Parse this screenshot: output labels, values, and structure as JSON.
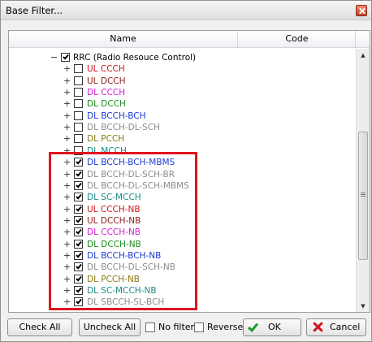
{
  "window": {
    "title": "Base Filter..."
  },
  "columns": {
    "name": "Name",
    "code": "Code"
  },
  "tree": {
    "root": {
      "expander": "−",
      "checked": true,
      "label": "RRC (Radio Resouce Control)",
      "color": "#000000"
    },
    "items": [
      {
        "expander": "+",
        "checked": false,
        "label": "UL CCCH",
        "color": "#d4141a"
      },
      {
        "expander": "+",
        "checked": false,
        "label": "UL DCCH",
        "color": "#8b1a1a"
      },
      {
        "expander": "+",
        "checked": false,
        "label": "DL CCCH",
        "color": "#d51dd6"
      },
      {
        "expander": "+",
        "checked": false,
        "label": "DL DCCH",
        "color": "#1c8a1c"
      },
      {
        "expander": "+",
        "checked": false,
        "label": "DL BCCH-BCH",
        "color": "#1c3ad2"
      },
      {
        "expander": "+",
        "checked": false,
        "label": "DL BCCH-DL-SCH",
        "color": "#8c8c8c"
      },
      {
        "expander": "+",
        "checked": false,
        "label": "DL PCCH",
        "color": "#8a7a10"
      },
      {
        "expander": "+",
        "checked": false,
        "label": "DL MCCH",
        "color": "#1a8a8a"
      },
      {
        "expander": "+",
        "checked": true,
        "label": "DL BCCH-BCH-MBMS",
        "color": "#1c3ad2"
      },
      {
        "expander": "+",
        "checked": true,
        "label": "DL BCCH-DL-SCH-BR",
        "color": "#8c8c8c"
      },
      {
        "expander": "+",
        "checked": true,
        "label": "DL BCCH-DL-SCH-MBMS",
        "color": "#8c8c8c"
      },
      {
        "expander": "+",
        "checked": true,
        "label": "DL SC-MCCH",
        "color": "#1a8a8a"
      },
      {
        "expander": "+",
        "checked": true,
        "label": "UL CCCH-NB",
        "color": "#d4141a"
      },
      {
        "expander": "+",
        "checked": true,
        "label": "UL DCCH-NB",
        "color": "#8b1a1a"
      },
      {
        "expander": "+",
        "checked": true,
        "label": "DL CCCH-NB",
        "color": "#d51dd6"
      },
      {
        "expander": "+",
        "checked": true,
        "label": "DL DCCH-NB",
        "color": "#1c8a1c"
      },
      {
        "expander": "+",
        "checked": true,
        "label": "DL BCCH-BCH-NB",
        "color": "#1c3ad2"
      },
      {
        "expander": "+",
        "checked": true,
        "label": "DL BCCH-DL-SCH-NB",
        "color": "#8c8c8c"
      },
      {
        "expander": "+",
        "checked": true,
        "label": "DL PCCH-NB",
        "color": "#8a7a10"
      },
      {
        "expander": "+",
        "checked": true,
        "label": "DL SC-MCCH-NB",
        "color": "#1a8a8a"
      },
      {
        "expander": "+",
        "checked": true,
        "label": "DL SBCCH-SL-BCH",
        "color": "#8c8c8c"
      }
    ]
  },
  "buttons": {
    "check_all": "Check All",
    "uncheck_all": "Uncheck All",
    "no_filter": "No filter",
    "reverse": "Reverse",
    "ok": "OK",
    "cancel": "Cancel"
  },
  "icons": {
    "ok": "checkmark-icon",
    "cancel": "x-icon",
    "close": "close-icon"
  },
  "colors": {
    "highlight": "#e0141c"
  }
}
